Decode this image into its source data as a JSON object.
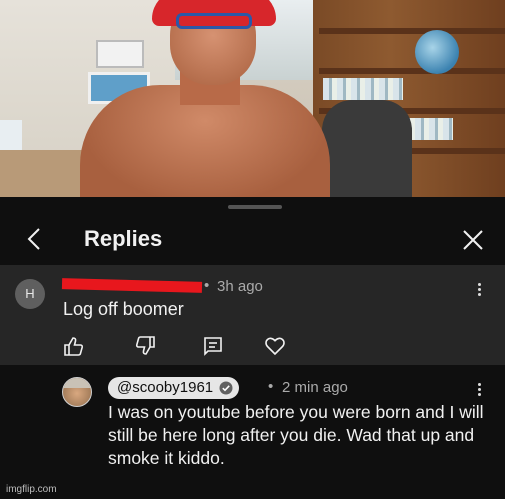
{
  "header": {
    "title": "Replies"
  },
  "comment": {
    "avatar_initial": "H",
    "time": "3h ago",
    "separator": "•",
    "text": "Log off boomer",
    "actions": [
      "like-icon",
      "dislike-icon",
      "reply-icon",
      "heart-icon"
    ]
  },
  "reply": {
    "handle": "@scooby1961",
    "separator": "•",
    "time": "2 min ago",
    "text": "I was on youtube before you were born and I will still be here long after you die.  Wad that up and smoke it kiddo."
  },
  "watermark": "imgflip.com",
  "colors": {
    "background": "#0f0f0f",
    "highlight": "#262626",
    "redaction": "#e8171d",
    "secondary_text": "#aaaaaa"
  }
}
